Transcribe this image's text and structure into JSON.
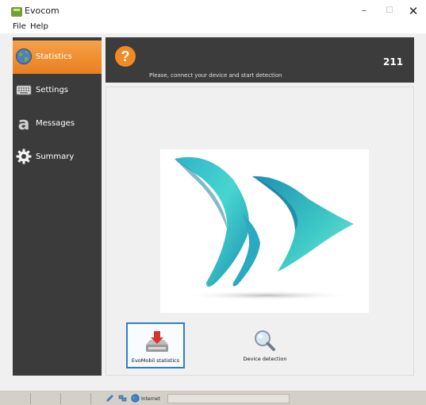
{
  "window": {
    "title": "Evocom",
    "minimize_glyph": "–",
    "maximize_glyph": "☐",
    "close_glyph": "✕"
  },
  "menu": {
    "items": [
      {
        "label": "File"
      },
      {
        "label": "Help"
      }
    ]
  },
  "sidebar": {
    "items": [
      {
        "label": "Statistics",
        "icon": "globe-icon",
        "active": true
      },
      {
        "label": "Settings",
        "icon": "keyboard-icon",
        "active": false
      },
      {
        "label": "Messages",
        "icon": "letter-a-icon",
        "active": false
      },
      {
        "label": "Summary",
        "icon": "gear-icon",
        "active": false
      }
    ]
  },
  "header": {
    "badge_glyph": "?",
    "message": "Please, connect your device and start detection",
    "number": "211"
  },
  "main": {
    "logo": "evocom-chevrons-logo",
    "tiles": [
      {
        "label": "EvoMobil statistics",
        "icon": "download-drive-icon",
        "selected": true
      },
      {
        "label": "Device detection",
        "icon": "magnifier-icon",
        "selected": false
      }
    ]
  },
  "statusbar": {
    "zone_label": "Internet",
    "icons": [
      "pencil-icon",
      "network-icon",
      "globe-icon"
    ]
  },
  "colors": {
    "accent_orange": "#f08a24",
    "sidebar_bg": "#3b3b3b",
    "header_bg": "#3c3c3c",
    "logo_teal": "#3ec9c6",
    "selection_blue": "#2f7fc8"
  }
}
